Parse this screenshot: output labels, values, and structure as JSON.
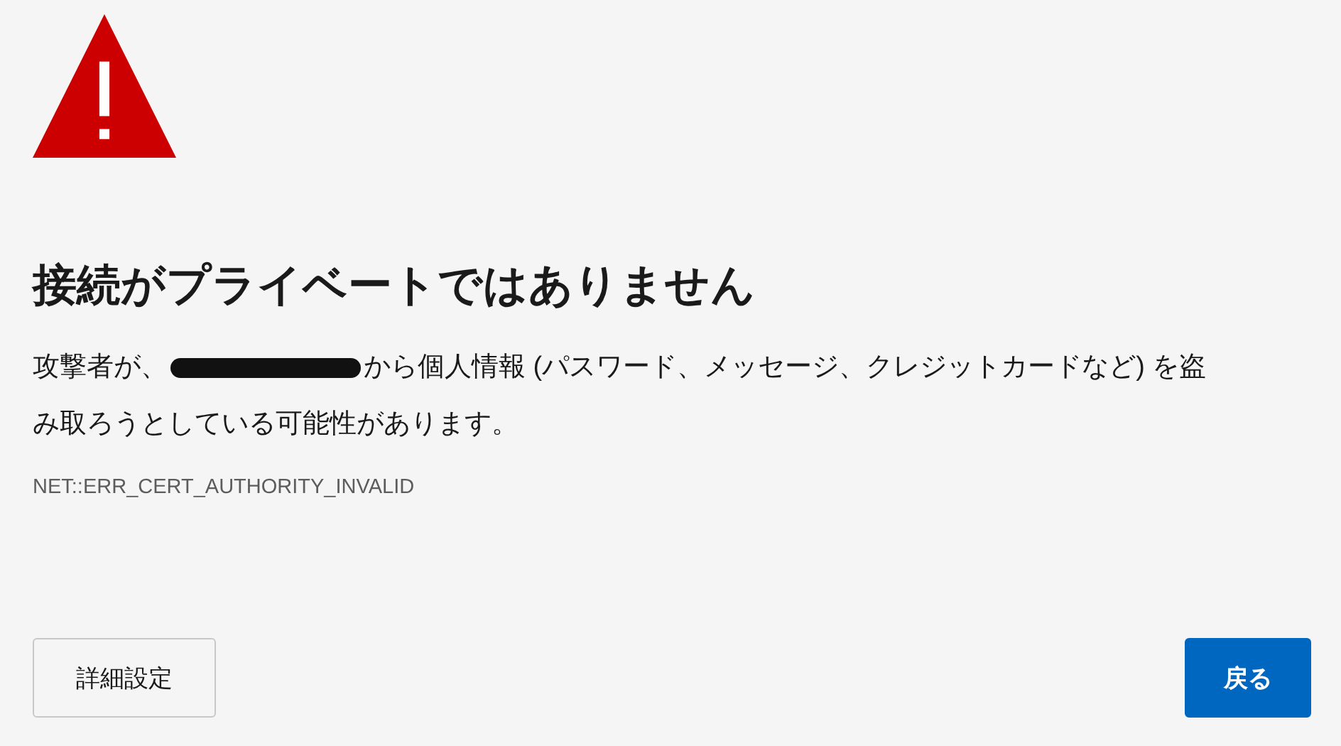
{
  "title": "接続がプライベートではありません",
  "message": {
    "before": "攻撃者が、",
    "redacted": true,
    "after": "から個人情報 (パスワード、メッセージ、クレジットカードなど) を盗",
    "continuation": "み取ろうとしている可能性があります。"
  },
  "error_code": "NET::ERR_CERT_AUTHORITY_INVALID",
  "buttons": [
    {
      "label": "詳細設定",
      "kind": "secondary"
    },
    {
      "label": "戻る",
      "kind": "primary"
    }
  ]
}
